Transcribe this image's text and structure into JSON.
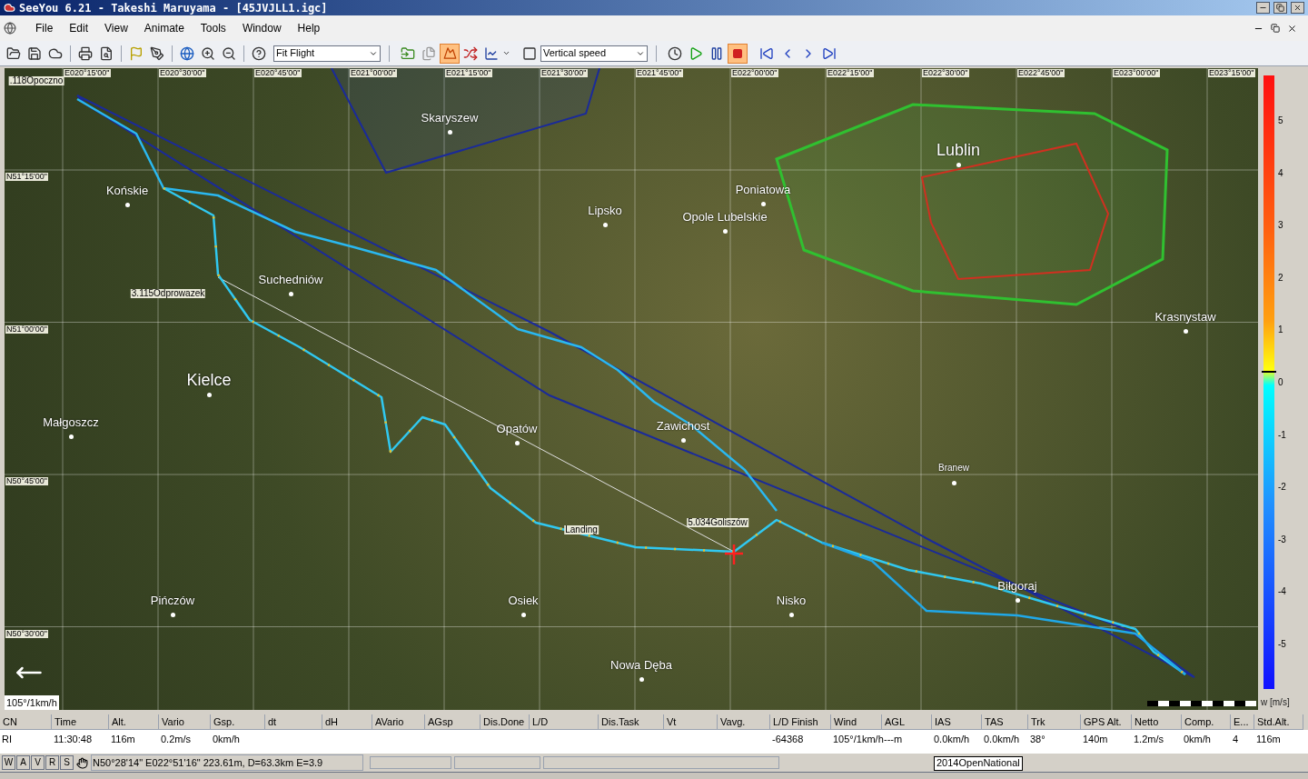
{
  "window": {
    "title": "SeeYou 6.21 - Takeshi Maruyama - [45JVJLL1.igc]"
  },
  "menu": [
    "File",
    "Edit",
    "View",
    "Animate",
    "Tools",
    "Window",
    "Help"
  ],
  "toolbar": {
    "zoom_select": "Fit Flight",
    "graph_select": "Vertical speed",
    "task_toggle": {
      "on": true
    }
  },
  "map": {
    "top_labels": [
      "E020°15'00\"",
      "E020°30'00\"",
      "E020°45'00\"",
      "E021°00'00\"",
      "E021°15'00\"",
      "E021°30'00\"",
      "E021°45'00\"",
      "E022°00'00\"",
      "E022°15'00\"",
      "E022°30'00\"",
      "E022°45'00\"",
      "E023°00'00\"",
      "E023°15'00\""
    ],
    "left_labels": [
      "N51°15'00\"",
      "N51°00'00\"",
      "N50°45'00\"",
      "N50°30'00\""
    ],
    "places": [
      {
        "name": "Skaryszew",
        "kind": "town"
      },
      {
        "name": "Końskie",
        "kind": "town"
      },
      {
        "name": "Lipsko",
        "kind": "town"
      },
      {
        "name": "Poniatowa",
        "kind": "town"
      },
      {
        "name": "Opole Lubelskie",
        "kind": "town"
      },
      {
        "name": "Lublin",
        "kind": "city"
      },
      {
        "name": "Suchedniów",
        "kind": "town"
      },
      {
        "name": "Krasnystaw",
        "kind": "town"
      },
      {
        "name": "Kielce",
        "kind": "city"
      },
      {
        "name": "Małgoszcz",
        "kind": "town"
      },
      {
        "name": "Opatów",
        "kind": "town"
      },
      {
        "name": "Zawichost",
        "kind": "town"
      },
      {
        "name": "Branew",
        "kind": "village"
      },
      {
        "name": "Biłgoraj",
        "kind": "town"
      },
      {
        "name": "Pińczów",
        "kind": "town"
      },
      {
        "name": "Osiek",
        "kind": "town"
      },
      {
        "name": "Nisko",
        "kind": "town"
      },
      {
        "name": "Nowa Dęba",
        "kind": "town"
      },
      {
        "name": ".118Opoczno",
        "kind": "waypoint"
      },
      {
        "name": "3.115Odprowazek",
        "kind": "waypoint"
      },
      {
        "name": "Landing",
        "kind": "waypoint"
      },
      {
        "name": "5.034Goliszów",
        "kind": "waypoint"
      }
    ],
    "scale_label": "105°/1km/h"
  },
  "legend": {
    "ticks": [
      "5",
      "4",
      "3",
      "2",
      "1",
      "0",
      "-1",
      "-2",
      "-3",
      "-4",
      "-5"
    ],
    "unit": "w [m/s]"
  },
  "table": {
    "columns": [
      {
        "header": "CN",
        "value": "RI"
      },
      {
        "header": "Time",
        "value": "11:30:48"
      },
      {
        "header": "Alt.",
        "value": "116m"
      },
      {
        "header": "Vario",
        "value": "0.2m/s"
      },
      {
        "header": "Gsp.",
        "value": "0km/h"
      },
      {
        "header": "dt"
      },
      {
        "header": "dH"
      },
      {
        "header": "AVario"
      },
      {
        "header": "AGsp"
      },
      {
        "header": "Dis.Done"
      },
      {
        "header": "L/D"
      },
      {
        "header": "Dis.Task"
      },
      {
        "header": "Vt"
      },
      {
        "header": "Vavg."
      },
      {
        "header": "L/D Finish",
        "value": "-64368"
      },
      {
        "header": "Wind",
        "value": "105°/1km/h"
      },
      {
        "header": "AGL",
        "value": "---m"
      },
      {
        "header": "IAS",
        "value": "0.0km/h"
      },
      {
        "header": "TAS",
        "value": "0.0km/h"
      },
      {
        "header": "Trk",
        "value": "38°"
      },
      {
        "header": "GPS Alt.",
        "value": "140m"
      },
      {
        "header": "Netto",
        "value": "1.2m/s"
      },
      {
        "header": "Comp.",
        "value": "0km/h"
      },
      {
        "header": "E...",
        "value": "4"
      },
      {
        "header": "Std.Alt.",
        "value": "116m"
      }
    ]
  },
  "status": {
    "buttons": [
      "W",
      "A",
      "V",
      "R",
      "S"
    ],
    "position": "N50°28'14\" E022°51'16\" 223.61m, D=63.3km E=3.9",
    "tooltip": "2014OpenNational"
  }
}
